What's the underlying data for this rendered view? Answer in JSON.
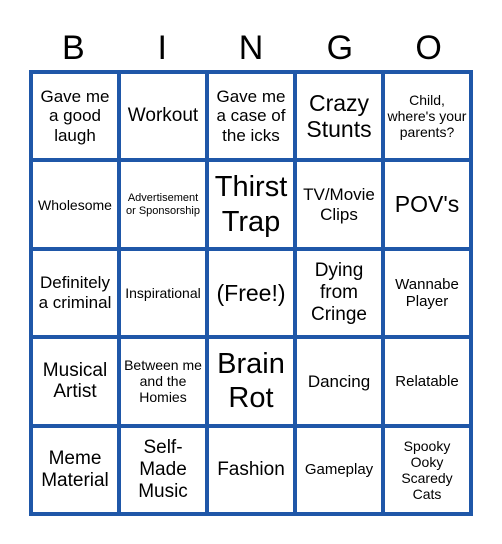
{
  "header": [
    "B",
    "I",
    "N",
    "G",
    "O"
  ],
  "border_color": "#1f57a8",
  "cells": [
    "Gave me a good laugh",
    "Workout",
    "Gave me a case of the icks",
    "Crazy Stunts",
    "Child, where's your parents?",
    "Wholesome",
    "Advertisement or Sponsorship",
    "Thirst Trap",
    "TV/Movie Clips",
    "POV's",
    "Definitely a criminal",
    "Inspirational",
    "(Free!)",
    "Dying from Cringe",
    "Wannabe Player",
    "Musical Artist",
    "Between me and the Homies",
    "Brain Rot",
    "Dancing",
    "Relatable",
    "Meme Material",
    "Self-Made Music",
    "Fashion",
    "Gameplay",
    "Spooky Ooky Scaredy Cats"
  ]
}
